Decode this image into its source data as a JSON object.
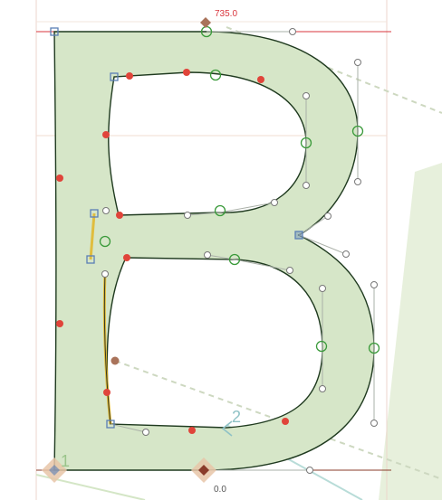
{
  "metrics": {
    "ascender_value": "735.0",
    "baseline_value": "0.0"
  },
  "anchors": {
    "anchor_1_label": "1",
    "anchor_2_label": "2"
  },
  "glyph": {
    "name_shown": "B",
    "fill_color": "#d6e6c8",
    "outline_color": "#1f3a1f"
  },
  "colors": {
    "ascender_line": "#d9363e",
    "baseline_line": "#8a3b2a",
    "metric_handle": "#a9735a",
    "oncurve_smooth": "#3a9a3a",
    "corner_node": "#5a7fb5",
    "selected_node": "#f0c020",
    "red_point": "#e0443a",
    "ghost_glyph": "#e7f0dc"
  }
}
